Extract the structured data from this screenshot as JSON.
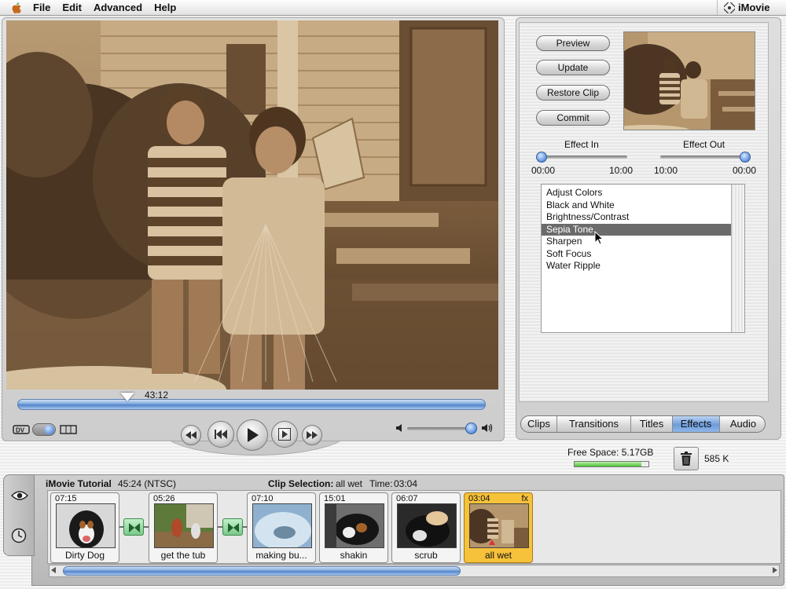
{
  "menubar": {
    "items": [
      "File",
      "Edit",
      "Advanced",
      "Help"
    ],
    "app_name": "iMovie"
  },
  "monitor": {
    "playhead_time": "43:12",
    "playhead_fraction": 0.24,
    "volume_fraction": 0.92
  },
  "effects_panel": {
    "buttons": {
      "preview": "Preview",
      "update": "Update",
      "restore_clip": "Restore Clip",
      "commit": "Commit"
    },
    "effect_in": {
      "label": "Effect In",
      "min": "00:00",
      "max": "10:00"
    },
    "effect_out": {
      "label": "Effect Out",
      "min": "10:00",
      "max": "00:00"
    },
    "effects": [
      "Adjust Colors",
      "Black and White",
      "Brightness/Contrast",
      "Sepia Tone",
      "Sharpen",
      "Soft Focus",
      "Water Ripple"
    ],
    "selected_effect": "Sepia Tone"
  },
  "tabs": [
    "Clips",
    "Transitions",
    "Titles",
    "Effects",
    "Audio"
  ],
  "active_tab": "Effects",
  "status": {
    "free_space": "Free Space: 5.17GB",
    "free_space_fraction": 0.9,
    "trash_size": "585 K"
  },
  "clip_viewer": {
    "project_title": "iMovie Tutorial",
    "duration": "45:24 (NTSC)",
    "clip_selection_label": "Clip Selection:",
    "clip_selection_value": "all wet",
    "time_label": "Time:",
    "time_value": "03:04",
    "clips": [
      {
        "duration": "07:15",
        "name": "Dirty Dog"
      },
      {
        "duration": "05:26",
        "name": "get the tub"
      },
      {
        "duration": "07:10",
        "name": "making bu..."
      },
      {
        "duration": "15:01",
        "name": "shakin"
      },
      {
        "duration": "06:07",
        "name": "scrub"
      },
      {
        "duration": "03:04",
        "name": "all wet",
        "fx": "fx"
      }
    ]
  },
  "colors": {
    "sepia": "#8a6c4a",
    "selection_gray": "#6b6b6b",
    "active_tab_blue": "#6d9ddc",
    "selected_clip": "#f6c23a",
    "transition_green": "#7ac98a"
  }
}
